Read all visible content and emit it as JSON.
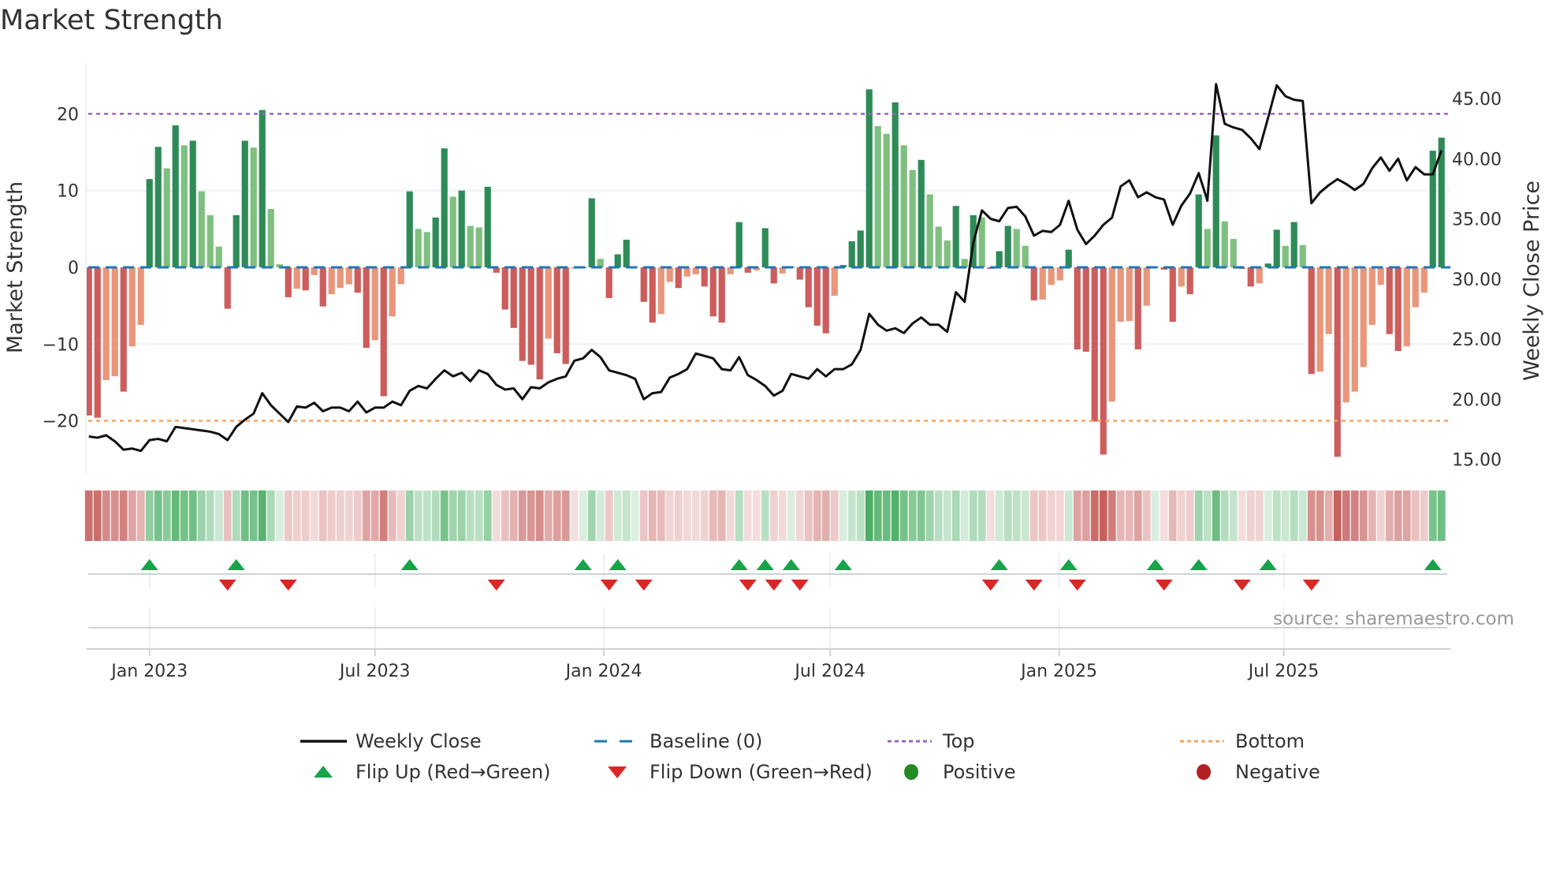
{
  "title": "Market Strength",
  "source": "source: sharemaestro.com",
  "chart_data": {
    "type": "bar",
    "title": "Market Strength",
    "ylabel": "Market Strength",
    "y2label": "Weekly Close Price",
    "ylim": [
      -25.5,
      25
    ],
    "y2lim": [
      13.5,
      47.5
    ],
    "yticks": [
      {
        "v": 20,
        "label": "20"
      },
      {
        "v": 10,
        "label": "10"
      },
      {
        "v": 0,
        "label": "0"
      },
      {
        "v": -10,
        "label": "−10"
      },
      {
        "v": -20,
        "label": "−20"
      }
    ],
    "y2ticks": [
      {
        "v": 45,
        "label": "45.00"
      },
      {
        "v": 40,
        "label": "40.00"
      },
      {
        "v": 35,
        "label": "35.00"
      },
      {
        "v": 30,
        "label": "30.00"
      },
      {
        "v": 25,
        "label": "25.00"
      },
      {
        "v": 20,
        "label": "20.00"
      },
      {
        "v": 15,
        "label": "15.00"
      }
    ],
    "xticks": [
      {
        "week": 8,
        "label": "Jan 2023"
      },
      {
        "week": 34,
        "label": "Jul 2023"
      },
      {
        "week": 60.4,
        "label": "Jan 2024"
      },
      {
        "week": 86.5,
        "label": "Jul 2024"
      },
      {
        "week": 112.9,
        "label": "Jan 2025"
      },
      {
        "week": 138.8,
        "label": "Jul 2025"
      }
    ],
    "top_level": 20,
    "bottom_level": -20,
    "baseline": 0,
    "colors": {
      "pos_dark": "#2e8b57",
      "pos_light": "#7fbf7f",
      "neg_dark": "#cd5c5c",
      "neg_light": "#e9967a",
      "baseline": "#1f77b4",
      "top": "#9467bd",
      "bottom": "#f4a460",
      "close": "#111111",
      "flip_up": "#16a34a",
      "flip_down": "#dc2626",
      "strip_pos": "#3aa655",
      "strip_neg": "#c0504d",
      "positive": "#228b22",
      "negative": "#b22222"
    },
    "strength": [
      -19.3,
      -19.6,
      -14.7,
      -14.2,
      -16.2,
      -10.3,
      -7.5,
      11.5,
      15.7,
      12.9,
      18.5,
      15.9,
      16.5,
      9.9,
      6.8,
      2.7,
      -5.4,
      6.8,
      16.5,
      15.6,
      20.5,
      7.6,
      0.4,
      -3.9,
      -2.8,
      -3.0,
      -1.0,
      -5.1,
      -3.5,
      -2.7,
      -2.2,
      -3.3,
      -10.5,
      -9.5,
      -16.8,
      -6.4,
      -2.2,
      9.9,
      5.0,
      4.6,
      6.5,
      15.5,
      9.2,
      10.0,
      5.4,
      5.2,
      10.5,
      -0.7,
      -5.5,
      -7.9,
      -12.2,
      -12.7,
      -14.6,
      -9.3,
      -11.2,
      -12.6,
      -0.1,
      0.05,
      9.0,
      1.1,
      -4.0,
      1.7,
      3.6,
      0.1,
      -4.5,
      -7.2,
      -6.1,
      -1.9,
      -2.7,
      -1.2,
      -0.9,
      -2.5,
      -6.4,
      -7.2,
      -0.9,
      5.9,
      -0.7,
      -0.4,
      5.1,
      -2.1,
      -0.8,
      0.1,
      -1.6,
      -5.2,
      -7.6,
      -8.6,
      -3.7,
      0.3,
      3.4,
      4.8,
      23.2,
      18.4,
      17.4,
      21.5,
      15.9,
      12.7,
      14.0,
      9.5,
      5.3,
      3.5,
      8.0,
      1.1,
      6.8,
      6.5,
      -0.2,
      2.1,
      5.4,
      5.0,
      2.8,
      -4.3,
      -4.2,
      -2.3,
      -1.7,
      2.3,
      -10.7,
      -11.0,
      -20.1,
      -24.4,
      -17.5,
      -7.1,
      -7.0,
      -10.7,
      -5.0,
      0.1,
      -0.3,
      -7.1,
      -2.5,
      -3.5,
      9.5,
      5.0,
      17.2,
      6.0,
      3.7,
      -0.2,
      -2.5,
      -2.1,
      0.5,
      4.9,
      2.8,
      5.9,
      2.9,
      -13.9,
      -13.6,
      -8.7,
      -24.7,
      -17.6,
      -16.2,
      -13.0,
      -7.5,
      -2.3,
      -8.7,
      -10.9,
      -10.3,
      -5.2,
      -3.3,
      15.2,
      16.9
    ],
    "weekly_close": [
      16.9,
      16.8,
      17.0,
      16.5,
      15.8,
      15.9,
      15.7,
      16.6,
      16.7,
      16.5,
      17.7,
      17.6,
      17.5,
      17.4,
      17.3,
      17.1,
      16.6,
      17.7,
      18.3,
      18.8,
      20.5,
      19.5,
      18.8,
      18.1,
      19.4,
      19.3,
      19.7,
      19.0,
      19.3,
      19.3,
      19.0,
      19.8,
      18.9,
      19.3,
      19.3,
      19.8,
      19.5,
      20.7,
      21.1,
      20.9,
      21.7,
      22.4,
      21.9,
      22.2,
      21.5,
      22.4,
      22.1,
      21.2,
      20.8,
      20.9,
      20.0,
      21.0,
      20.9,
      21.4,
      21.7,
      21.9,
      23.2,
      23.4,
      24.1,
      23.5,
      22.4,
      22.2,
      22.0,
      21.7,
      20.0,
      20.5,
      20.6,
      21.8,
      22.1,
      22.5,
      23.8,
      23.6,
      23.4,
      22.5,
      22.4,
      23.5,
      22.0,
      21.6,
      21.1,
      20.3,
      20.7,
      22.1,
      21.9,
      21.7,
      22.5,
      21.9,
      22.5,
      22.5,
      22.9,
      24.1,
      27.1,
      26.2,
      25.7,
      25.9,
      25.5,
      26.3,
      26.8,
      26.2,
      26.2,
      25.6,
      28.9,
      28.1,
      33.0,
      35.7,
      35.0,
      34.8,
      35.9,
      36.0,
      35.2,
      33.6,
      34.0,
      33.9,
      34.5,
      36.5,
      34.1,
      32.9,
      33.6,
      34.5,
      35.1,
      37.7,
      38.2,
      36.8,
      37.2,
      36.8,
      36.6,
      34.5,
      36.1,
      37.1,
      38.8,
      36.5,
      46.2,
      42.9,
      42.6,
      42.4,
      41.7,
      40.8,
      43.4,
      46.1,
      45.2,
      44.9,
      44.8,
      36.3,
      37.2,
      37.8,
      38.3,
      37.9,
      37.4,
      37.9,
      39.2,
      40.1,
      39.0,
      40.0,
      38.2,
      39.3,
      38.7,
      38.7,
      40.7
    ],
    "legend": [
      {
        "key": "close",
        "label": "Weekly Close"
      },
      {
        "key": "baseline",
        "label": "Baseline (0)"
      },
      {
        "key": "top",
        "label": "Top"
      },
      {
        "key": "bottom",
        "label": "Bottom"
      },
      {
        "key": "flip_up",
        "label": "Flip Up (Red→Green)"
      },
      {
        "key": "flip_down",
        "label": "Flip Down (Green→Red)"
      },
      {
        "key": "positive",
        "label": "Positive"
      },
      {
        "key": "negative",
        "label": "Negative"
      }
    ],
    "legend_placement": "bottom"
  }
}
